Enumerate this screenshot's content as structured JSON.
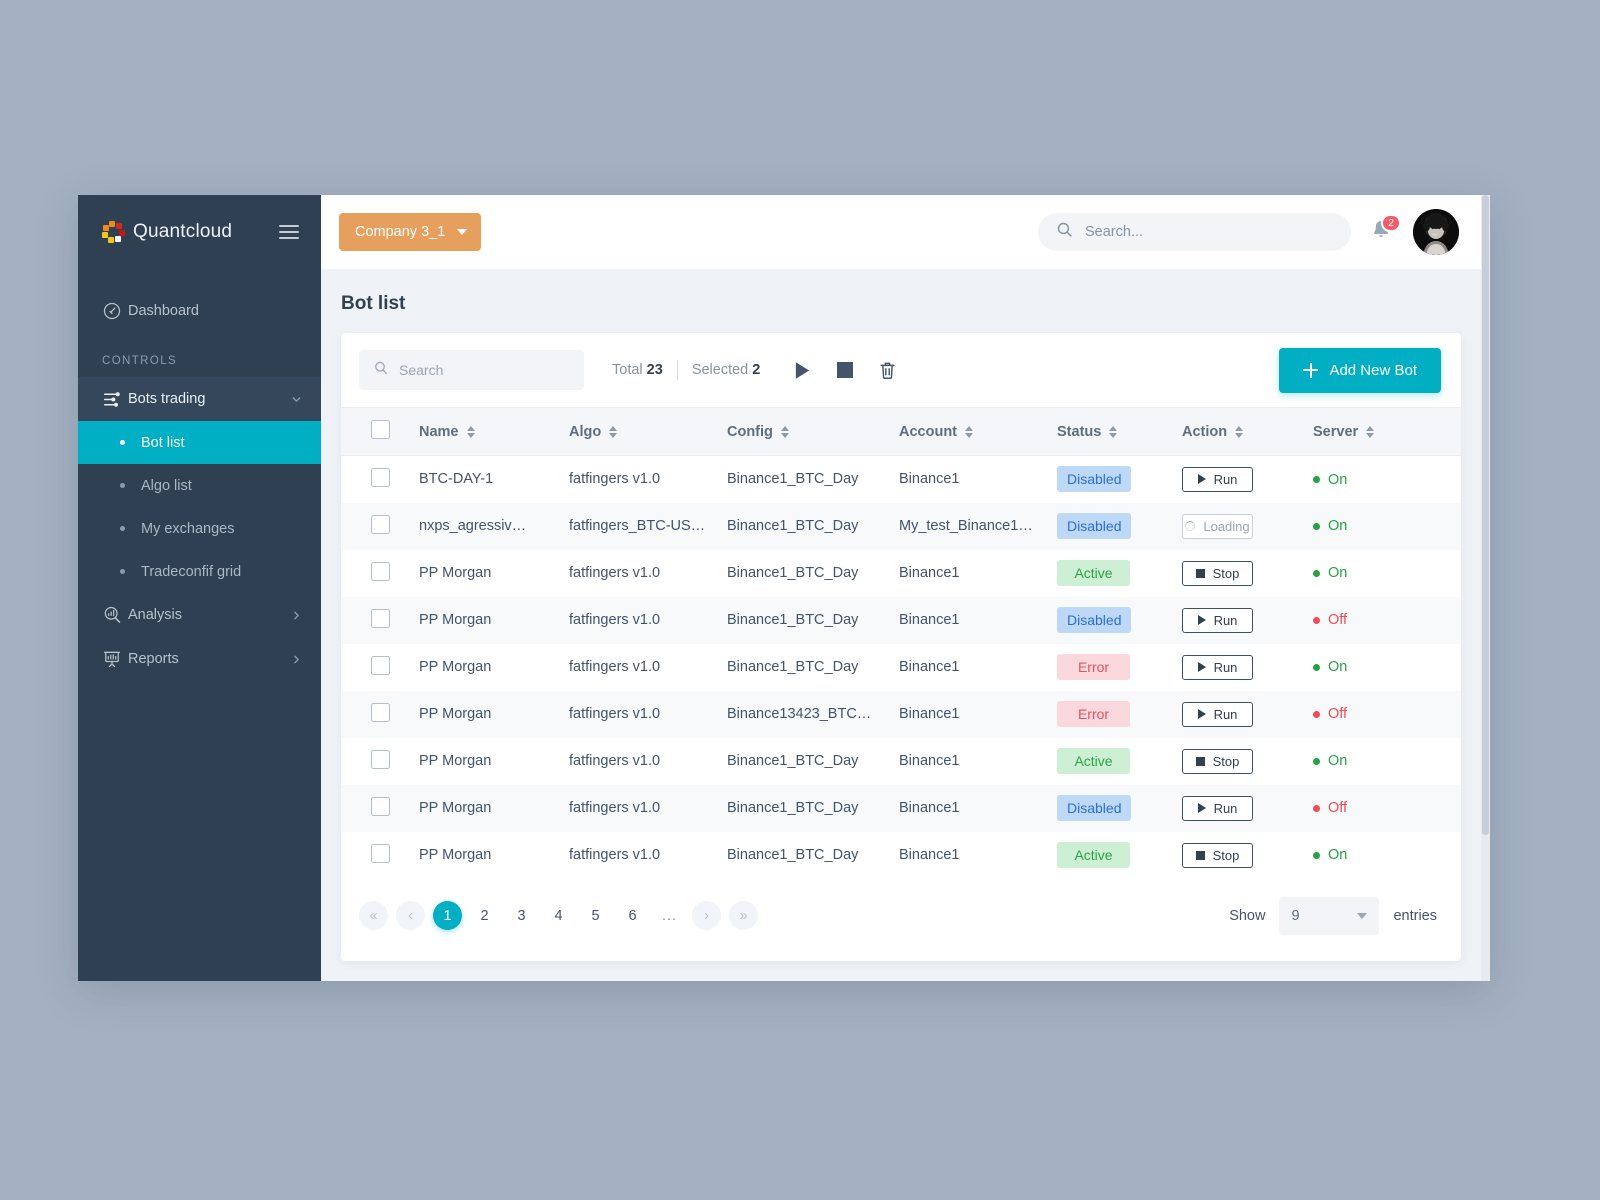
{
  "brand": {
    "name": "Quantcloud",
    "menu_icon": "hamburger-icon",
    "logo_icon": "quantcloud-logo-icon"
  },
  "sidebar": {
    "section_label": "CONTROLS",
    "dashboard": {
      "label": "Dashboard",
      "icon": "speedometer-icon"
    },
    "group": {
      "label": "Bots trading",
      "icon": "sliders-icon",
      "chevron": "chevron-down-icon"
    },
    "sub_items": [
      {
        "label": "Bot list",
        "active": true
      },
      {
        "label": "Algo list",
        "active": false
      },
      {
        "label": "My exchanges",
        "active": false
      },
      {
        "label": "Tradeconfif grid",
        "active": false
      }
    ],
    "items": [
      {
        "label": "Analysis",
        "icon": "analysis-magnifier-icon",
        "chevron": "chevron-right-icon"
      },
      {
        "label": "Reports",
        "icon": "reports-chart-icon",
        "chevron": "chevron-right-icon"
      }
    ]
  },
  "topbar": {
    "company": {
      "label": "Company 3_1",
      "color": "#e79f5e"
    },
    "search": {
      "placeholder": "Search...",
      "value": "",
      "icon": "search-icon"
    },
    "notifications": {
      "count": "2",
      "icon": "bell-icon",
      "badge_color": "#f45b69"
    },
    "avatar": "user-avatar"
  },
  "page": {
    "title": "Bot list"
  },
  "toolbar": {
    "search": {
      "placeholder": "Search",
      "value": "",
      "icon": "search-icon"
    },
    "total_label": "Total",
    "total_value": "23",
    "selected_label": "Selected",
    "selected_value": "2",
    "icons": [
      {
        "name": "run-all-icon"
      },
      {
        "name": "stop-all-icon"
      },
      {
        "name": "delete-icon"
      }
    ],
    "add_button": {
      "label": "Add New Bot",
      "icon": "plus-icon",
      "color": "#00afc4"
    }
  },
  "table": {
    "columns": [
      {
        "key": "name",
        "label": "Name"
      },
      {
        "key": "algo",
        "label": "Algo"
      },
      {
        "key": "config",
        "label": "Config"
      },
      {
        "key": "account",
        "label": "Account"
      },
      {
        "key": "status",
        "label": "Status"
      },
      {
        "key": "action",
        "label": "Action"
      },
      {
        "key": "server",
        "label": "Server"
      }
    ],
    "rows": [
      {
        "name": "BTC-DAY-1",
        "algo": "fatfingers v1.0",
        "config": "Binance1_BTC_Day",
        "account": "Binance1",
        "status": "Disabled",
        "status_kind": "disabled",
        "action": "Run",
        "action_kind": "run",
        "server": "On",
        "server_kind": "on"
      },
      {
        "name": "nxps_agressiv…",
        "algo": "fatfingers_BTC-US…",
        "config": "Binance1_BTC_Day",
        "account": "My_test_Binance1…",
        "status": "Disabled",
        "status_kind": "disabled",
        "action": "Loading",
        "action_kind": "loading",
        "server": "On",
        "server_kind": "on"
      },
      {
        "name": "PP Morgan",
        "algo": "fatfingers v1.0",
        "config": "Binance1_BTC_Day",
        "account": "Binance1",
        "status": "Active",
        "status_kind": "active",
        "action": "Stop",
        "action_kind": "stop",
        "server": "On",
        "server_kind": "on"
      },
      {
        "name": "PP Morgan",
        "algo": "fatfingers v1.0",
        "config": "Binance1_BTC_Day",
        "account": "Binance1",
        "status": "Disabled",
        "status_kind": "disabled",
        "action": "Run",
        "action_kind": "run",
        "server": "Off",
        "server_kind": "off"
      },
      {
        "name": "PP Morgan",
        "algo": "fatfingers v1.0",
        "config": "Binance1_BTC_Day",
        "account": "Binance1",
        "status": "Error",
        "status_kind": "error",
        "action": "Run",
        "action_kind": "run",
        "server": "On",
        "server_kind": "on"
      },
      {
        "name": "PP Morgan",
        "algo": "fatfingers v1.0",
        "config": "Binance13423_BTC…",
        "account": "Binance1",
        "status": "Error",
        "status_kind": "error",
        "action": "Run",
        "action_kind": "run",
        "server": "Off",
        "server_kind": "off"
      },
      {
        "name": "PP Morgan",
        "algo": "fatfingers v1.0",
        "config": "Binance1_BTC_Day",
        "account": "Binance1",
        "status": "Active",
        "status_kind": "active",
        "action": "Stop",
        "action_kind": "stop",
        "server": "On",
        "server_kind": "on"
      },
      {
        "name": "PP Morgan",
        "algo": "fatfingers v1.0",
        "config": "Binance1_BTC_Day",
        "account": "Binance1",
        "status": "Disabled",
        "status_kind": "disabled",
        "action": "Run",
        "action_kind": "run",
        "server": "Off",
        "server_kind": "off"
      },
      {
        "name": "PP Morgan",
        "algo": "fatfingers v1.0",
        "config": "Binance1_BTC_Day",
        "account": "Binance1",
        "status": "Active",
        "status_kind": "active",
        "action": "Stop",
        "action_kind": "stop",
        "server": "On",
        "server_kind": "on"
      }
    ]
  },
  "pagination": {
    "first": "«",
    "prev": "‹",
    "next": "›",
    "last": "»",
    "pages": [
      "1",
      "2",
      "3",
      "4",
      "5",
      "6"
    ],
    "ellipsis": "...",
    "current": "1",
    "show_label": "Show",
    "entries_label": "entries",
    "page_size": "9"
  }
}
